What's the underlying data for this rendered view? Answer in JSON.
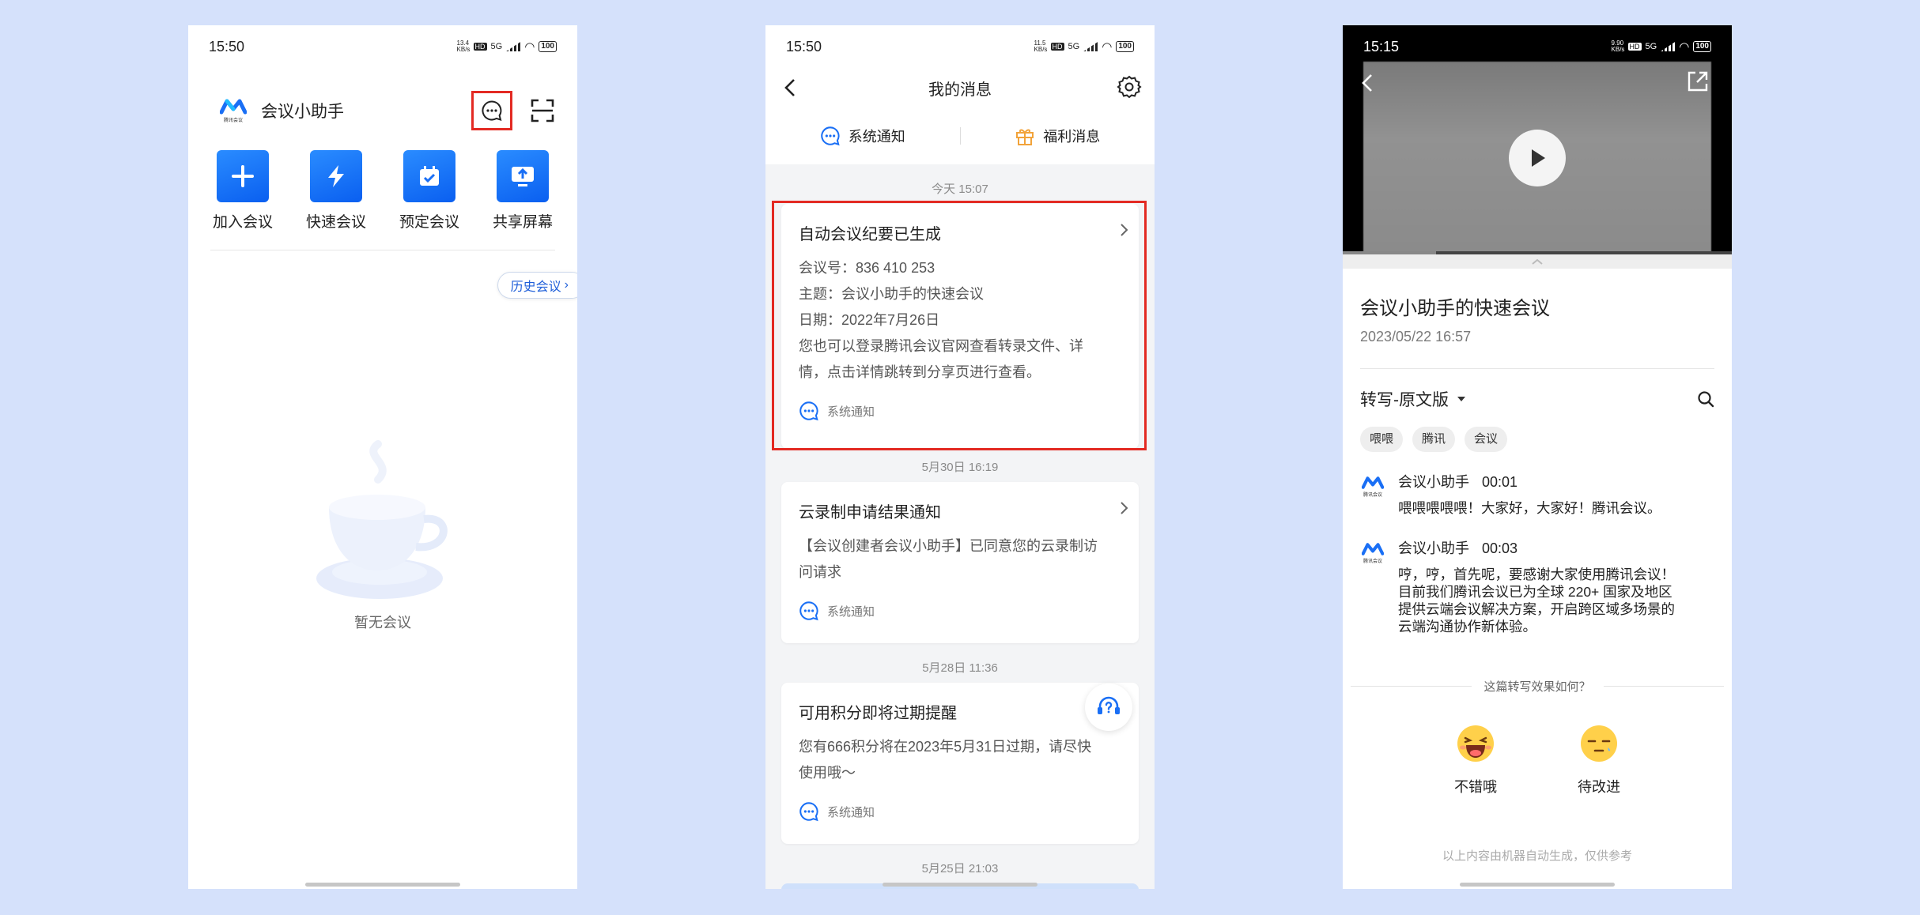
{
  "phone1": {
    "status": {
      "time": "15:50",
      "speed": "13.4 KB/s",
      "network": "5G",
      "battery": "100"
    },
    "app_title": "会议小助手",
    "logo_text": "腾讯会议",
    "actions": [
      {
        "label": "加入会议",
        "icon": "plus-icon"
      },
      {
        "label": "快速会议",
        "icon": "lightning-icon"
      },
      {
        "label": "预定会议",
        "icon": "calendar-check-icon"
      },
      {
        "label": "共享屏幕",
        "icon": "share-screen-icon"
      }
    ],
    "history_label": "历史会议",
    "empty_text": "暂无会议",
    "highlight_color": "#e32a23"
  },
  "phone2": {
    "status": {
      "time": "15:50",
      "speed": "11.5 KB/s",
      "network": "5G",
      "battery": "100"
    },
    "title": "我的消息",
    "tabs": [
      {
        "label": "系统通知",
        "icon": "chat-bubble-icon"
      },
      {
        "label": "福利消息",
        "icon": "gift-icon"
      }
    ],
    "messages": [
      {
        "date": "今天 15:07",
        "title": "自动会议纪要已生成",
        "lines": [
          "会议号：836 410 253",
          "主题：会议小助手的快速会议",
          "日期：2022年7月26日",
          "您也可以登录腾讯会议官网查看转录文件、详",
          "情，点击详情跳转到分享页进行查看。"
        ],
        "source": "系统通知"
      },
      {
        "date": "5月30日 16:19",
        "title": "云录制申请结果通知",
        "lines": [
          "【会议创建者会议小助手】已同意您的云录制访",
          "问请求"
        ],
        "source": "系统通知"
      },
      {
        "date": "5月28日 11:36",
        "title": "可用积分即将过期提醒",
        "lines": [
          "您有666积分将在2023年5月31日过期，请尽快",
          "使用哦～"
        ],
        "source": "系统通知"
      }
    ],
    "last_date": "5月25日 21:03"
  },
  "phone3": {
    "status": {
      "time": "15:15",
      "speed": "9.90 KB/s",
      "network": "5G",
      "battery": "100"
    },
    "video_progress": 0.24,
    "title": "会议小助手的快速会议",
    "datetime": "2023/05/22 16:57",
    "transcript_label": "转写-原文版",
    "tags": [
      "喂喂",
      "腾讯",
      "会议"
    ],
    "entries": [
      {
        "speaker": "会议小助手",
        "time": "00:01",
        "lines": [
          "喂喂喂喂喂！大家好，大家好！腾讯会议。"
        ]
      },
      {
        "speaker": "会议小助手",
        "time": "00:03",
        "lines": [
          "哼，哼，首先呢，要感谢大家使用腾讯会议！",
          "目前我们腾讯会议已为全球 220+ 国家及地区",
          "提供云端会议解决方案，开启跨区域多场景的",
          "云端沟通协作新体验。"
        ]
      }
    ],
    "logo_text": "腾讯会议",
    "feedback_question": "这篇转写效果如何？",
    "reactions": [
      {
        "label": "不错哦",
        "icon": "laughing-face-icon"
      },
      {
        "label": "待改进",
        "icon": "sleepy-face-icon"
      }
    ],
    "disclaimer": "以上内容由机器自动生成，仅供参考"
  },
  "colors": {
    "background": "#d5e1fb",
    "accent": "#1a6ff5",
    "highlight": "#e32a23"
  }
}
